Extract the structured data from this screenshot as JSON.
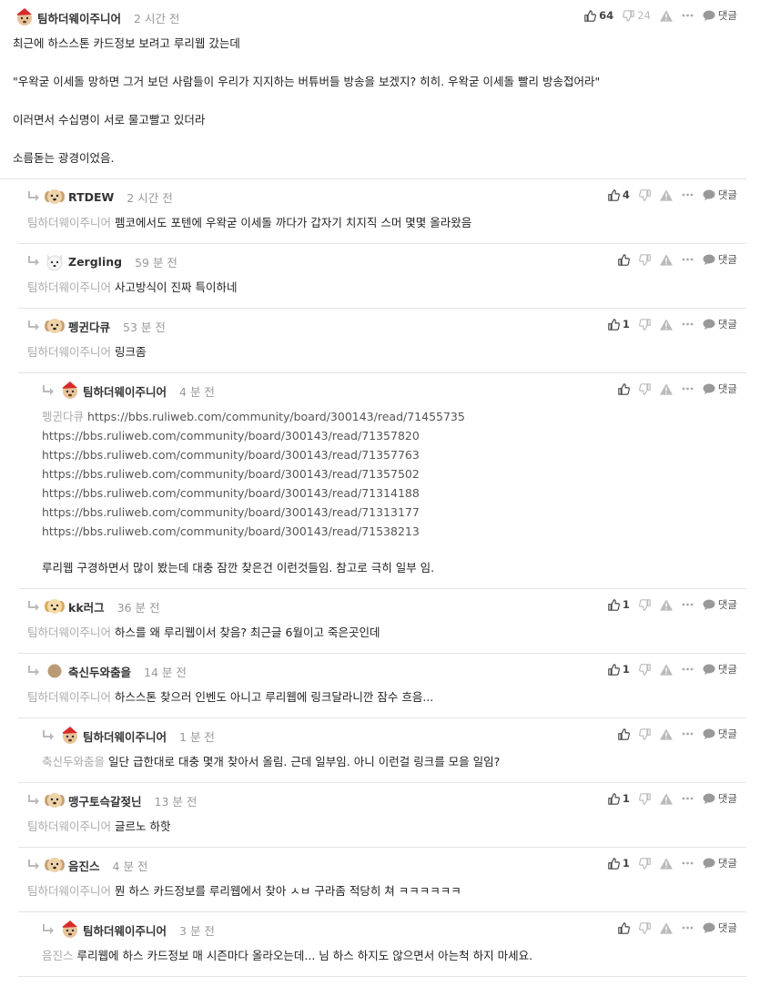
{
  "icons": {
    "reply_arrow": "reply-arrow-icon",
    "like": "thumbs-up-icon",
    "dislike": "thumbs-down-icon",
    "report": "warning-icon",
    "more": "more-dots-icon",
    "reply": "speech-bubble-icon"
  },
  "comments": [
    {
      "nickname": "팀하더웨이주니어",
      "time": "2 시간 전",
      "likes": "64",
      "dislikes": "24",
      "reply_label": "댓글",
      "lines": [
        "최근에 하스스톤 카드정보 보려고 루리웹 갔는데",
        "",
        "\"우왁굳 이세돌 망하면 그거 보던 사람들이 우리가 지지하는 버튜버들 방송을 보겠지? 히히. 우왁굳 이세돌 빨리 방송접어라\"",
        "",
        "이러면서 수십명이 서로 물고빨고 있더라",
        "",
        "소름돋는 광경이었음."
      ]
    },
    {
      "nickname": "RTDEW",
      "time": "2 시간 전",
      "likes": "4",
      "reply_label": "댓글",
      "mention": "팀하더웨이주니어",
      "text": "펨코에서도 포텐에 우왁굳 이세돌 까다가 갑자기 치지직 스머 몇몇 올라왔음"
    },
    {
      "nickname": "Zergling",
      "time": "59 분 전",
      "reply_label": "댓글",
      "mention": "팀하더웨이주니어",
      "text": "사고방식이 진짜 특이하네"
    },
    {
      "nickname": "펭귄다큐",
      "time": "53 분 전",
      "likes": "1",
      "reply_label": "댓글",
      "mention": "팀하더웨이주니어",
      "text": "링크좀"
    },
    {
      "nickname": "팀하더웨이주니어",
      "time": "4 분 전",
      "reply_label": "댓글",
      "mention": "펭귄다큐",
      "links": [
        "https://bbs.ruliweb.com/community/board/300143/read/71455735",
        "https://bbs.ruliweb.com/community/board/300143/read/71357820",
        "https://bbs.ruliweb.com/community/board/300143/read/71357763",
        "https://bbs.ruliweb.com/community/board/300143/read/71357502",
        "https://bbs.ruliweb.com/community/board/300143/read/71314188",
        "https://bbs.ruliweb.com/community/board/300143/read/71313177",
        "https://bbs.ruliweb.com/community/board/300143/read/71538213"
      ],
      "text": "루리웹 구경하면서 많이 봤는데 대충 잠깐 찾은건 이런것들임. 참고로 극히 일부 임."
    },
    {
      "nickname": "kk러그",
      "time": "36 분 전",
      "likes": "1",
      "reply_label": "댓글",
      "mention": "팀하더웨이주니어",
      "text": "하스를 왜 루리웹이서 찾음? 최근글 6월이고 죽은곳인데"
    },
    {
      "nickname": "축신두와춤을",
      "time": "14 분 전",
      "likes": "1",
      "reply_label": "댓글",
      "mention": "팀하더웨이주니어",
      "text": "하스스톤 찾으러 인벤도 아니고 루리웹에 링크달라니깐 잠수 흐음..."
    },
    {
      "nickname": "팀하더웨이주니어",
      "time": "1 분 전",
      "reply_label": "댓글",
      "mention": "축신두와춤을",
      "text": "일단 급한대로 대충 몇개 찾아서 올림. 근데 일부임. 아니 이런걸 링크를 모을 일임?"
    },
    {
      "nickname": "맹구토슥갈젖닌",
      "time": "13 분 전",
      "likes": "1",
      "reply_label": "댓글",
      "mention": "팀하더웨이주니어",
      "text": "글르노 하핫"
    },
    {
      "nickname": "음진스",
      "time": "4 분 전",
      "likes": "1",
      "reply_label": "댓글",
      "mention": "팀하더웨이주니어",
      "text": "뭔 하스 카드정보를 루리웹에서 찾아 ㅅㅂ 구라좀 적당히 쳐 ㅋㅋㅋㅋㅋㅋ"
    },
    {
      "nickname": "팀하더웨이주니어",
      "time": "3 분 전",
      "reply_label": "댓글",
      "mention": "음진스",
      "text": "루리웹에 하스 카드정보 매 시즌마다 올라오는데... 님 하스 하지도 않으면서 아는척 하지 마세요."
    }
  ]
}
